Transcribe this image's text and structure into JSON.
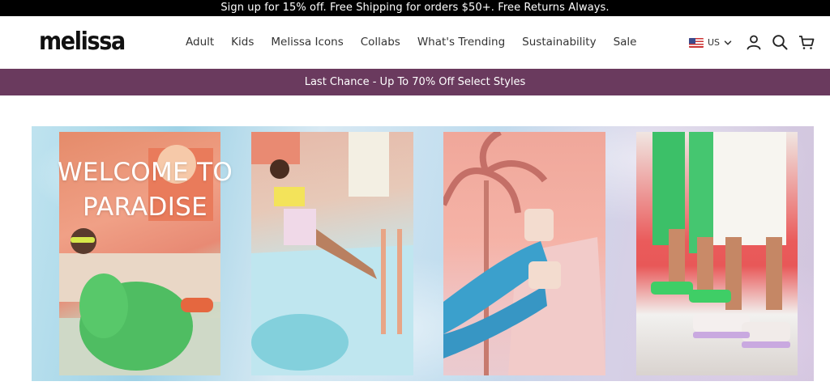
{
  "announcement": "Sign up for 15% off. Free Shipping for orders $50+. Free Returns Always.",
  "header": {
    "logo": "melissa",
    "nav": [
      "Adult",
      "Kids",
      "Melissa Icons",
      "Collabs",
      "What's Trending",
      "Sustainability",
      "Sale"
    ],
    "locale": "US",
    "icons": [
      "account-icon",
      "search-icon",
      "cart-icon"
    ]
  },
  "promo": "Last Chance - Up To 70% Off Select Styles",
  "hero": {
    "headline_line1": "WELCOME TO",
    "headline_line2": "PARADISE"
  },
  "colors": {
    "promo_bg": "#6a3a5e",
    "announcement_bg": "#000000"
  }
}
